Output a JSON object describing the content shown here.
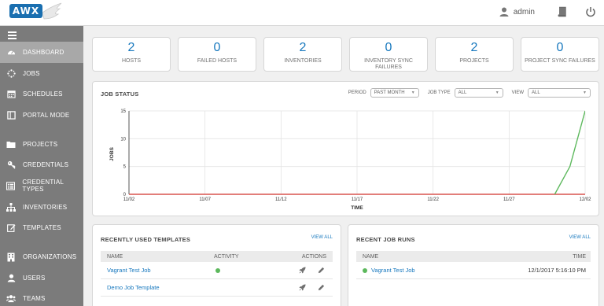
{
  "header": {
    "logo_text": "AWX",
    "username": "admin",
    "icons": [
      "user-icon",
      "docs-icon",
      "power-icon"
    ]
  },
  "sidebar": {
    "items": [
      {
        "label": "DASHBOARD",
        "icon": "dashboard-icon",
        "active": true
      },
      {
        "label": "JOBS",
        "icon": "spinner-icon"
      },
      {
        "label": "SCHEDULES",
        "icon": "calendar-icon"
      },
      {
        "label": "PORTAL MODE",
        "icon": "portal-icon"
      },
      {
        "label": "PROJECTS",
        "icon": "folder-icon"
      },
      {
        "label": "CREDENTIALS",
        "icon": "key-icon"
      },
      {
        "label": "CREDENTIAL TYPES",
        "icon": "list-icon"
      },
      {
        "label": "INVENTORIES",
        "icon": "sitemap-icon"
      },
      {
        "label": "TEMPLATES",
        "icon": "edit-icon"
      },
      {
        "label": "ORGANIZATIONS",
        "icon": "building-icon"
      },
      {
        "label": "USERS",
        "icon": "user-icon"
      },
      {
        "label": "TEAMS",
        "icon": "users-icon"
      }
    ]
  },
  "counts": [
    {
      "value": "2",
      "label": "HOSTS"
    },
    {
      "value": "0",
      "label": "FAILED HOSTS"
    },
    {
      "value": "2",
      "label": "INVENTORIES"
    },
    {
      "value": "0",
      "label": "INVENTORY SYNC FAILURES"
    },
    {
      "value": "2",
      "label": "PROJECTS"
    },
    {
      "value": "0",
      "label": "PROJECT SYNC FAILURES"
    }
  ],
  "job_status": {
    "title": "JOB STATUS",
    "period_label": "PERIOD",
    "period_value": "PAST MONTH",
    "job_type_label": "JOB TYPE",
    "job_type_value": "ALL",
    "view_label": "VIEW",
    "view_value": "ALL"
  },
  "chart_data": {
    "type": "line",
    "xlabel": "TIME",
    "ylabel": "JOBS",
    "ylim": [
      0,
      15
    ],
    "yticks": [
      "0",
      "5",
      "10",
      "15"
    ],
    "xticks": [
      "11/02",
      "11/07",
      "11/12",
      "11/17",
      "11/22",
      "11/27",
      "12/02"
    ],
    "x_start": "11/02",
    "x_end": "12/02",
    "grid": true,
    "series": [
      {
        "color": "#5cb85c",
        "points": [
          [
            "11/30",
            0
          ],
          [
            "12/01",
            5
          ],
          [
            "12/02",
            15
          ],
          [
            "12/03",
            0
          ]
        ]
      },
      {
        "color": "#d9534f",
        "points": [
          [
            "11/02",
            0
          ],
          [
            "12/03",
            0
          ]
        ]
      }
    ]
  },
  "recent_templates": {
    "title": "RECENTLY USED TEMPLATES",
    "view_all": "VIEW ALL",
    "columns": {
      "name": "NAME",
      "activity": "ACTIVITY",
      "actions": "ACTIONS"
    },
    "rows": [
      {
        "name": "Vagrant Test Job",
        "activity": "success"
      },
      {
        "name": "Demo Job Template",
        "activity": ""
      }
    ]
  },
  "recent_runs": {
    "title": "RECENT JOB RUNS",
    "view_all": "VIEW ALL",
    "columns": {
      "name": "NAME",
      "time": "TIME"
    },
    "rows": [
      {
        "name": "Vagrant Test Job",
        "time": "12/1/2017 5:16:10 PM",
        "status": "success"
      }
    ]
  }
}
